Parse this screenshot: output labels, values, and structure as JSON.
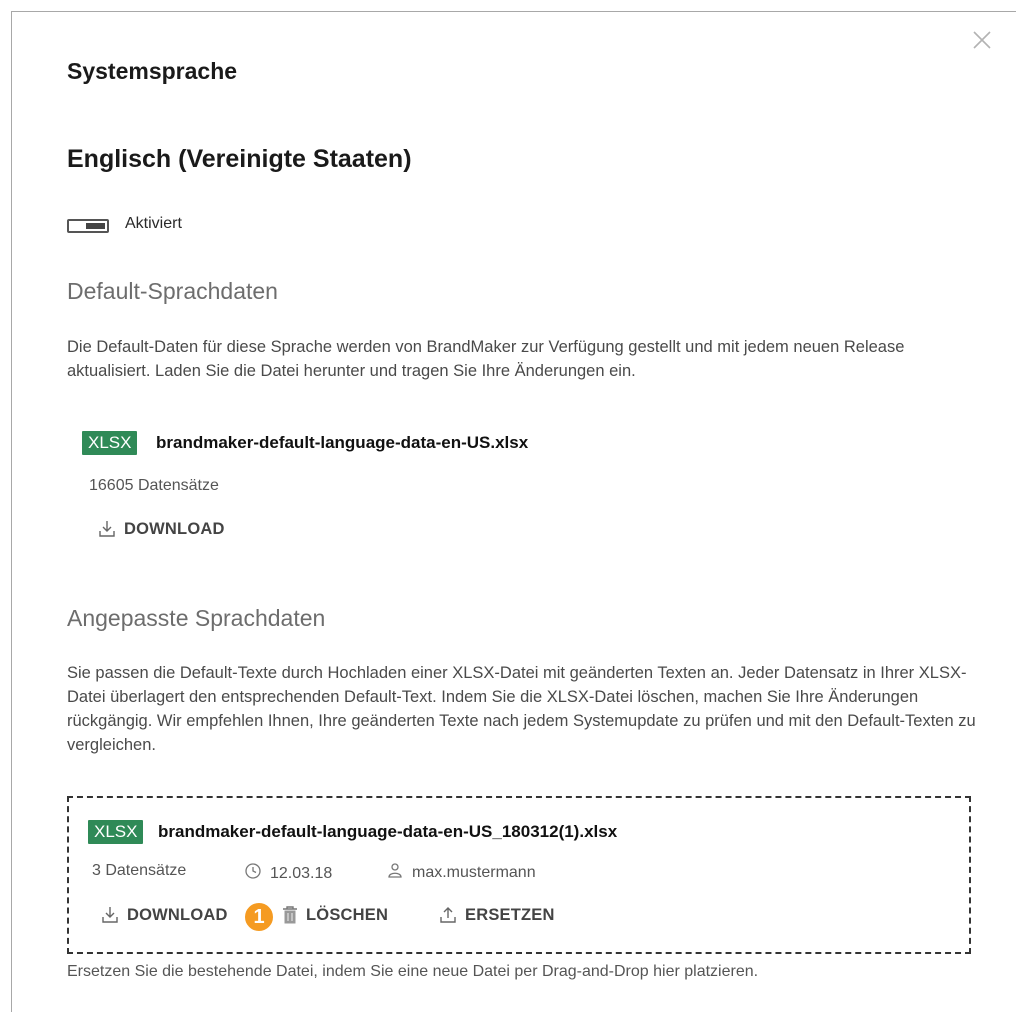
{
  "dialog": {
    "title": "Systemsprache",
    "language": "Englisch (Vereinigte Staaten)",
    "toggle_label": "Aktiviert",
    "toggle_on": true
  },
  "default_section": {
    "heading": "Default-Sprachdaten",
    "description": "Die Default-Daten für diese Sprache werden von BrandMaker zur Verfügung gestellt und mit jedem neuen Release aktualisiert. Laden Sie die Datei herunter und tragen Sie Ihre Änderungen ein.",
    "file": {
      "badge": "XLSX",
      "name": "brandmaker-default-language-data-en-US.xlsx",
      "records": "16605 Datensätze",
      "download_label": "DOWNLOAD"
    }
  },
  "custom_section": {
    "heading": "Angepasste Sprachdaten",
    "description": "Sie passen die Default-Texte durch Hochladen einer XLSX-Datei mit geänderten Texten an. Jeder Datensatz in Ihrer XLSX-Datei überlagert den entsprechenden Default-Text. Indem Sie die XLSX-Datei löschen, machen Sie Ihre Änderungen rückgängig. Wir empfehlen Ihnen, Ihre geänderten Texte nach jedem Systemupdate zu prüfen und mit den Default-Texten zu vergleichen.",
    "file": {
      "badge": "XLSX",
      "name": "brandmaker-default-language-data-en-US_180312(1).xlsx",
      "records": "3 Datensätze",
      "date": "12.03.18",
      "user": "max.mustermann",
      "download_label": "DOWNLOAD",
      "delete_label": "LÖSCHEN",
      "replace_label": "ERSETZEN"
    },
    "dropzone_hint": "Ersetzen Sie die bestehende Datei, indem Sie eine neue Datei per Drag-and-Drop hier platzieren."
  },
  "callout": {
    "number": "1"
  },
  "colors": {
    "badge": "#2f8a57",
    "callout": "#f59b22"
  },
  "icons": [
    "close-icon",
    "download-icon",
    "clock-icon",
    "user-icon",
    "trash-icon",
    "upload-icon"
  ]
}
